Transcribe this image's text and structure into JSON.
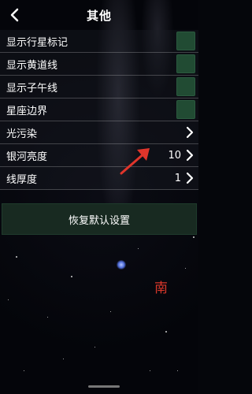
{
  "header": {
    "title": "其他"
  },
  "rows": [
    {
      "label": "显示行星标记",
      "type": "toggle"
    },
    {
      "label": "显示黄道线",
      "type": "toggle"
    },
    {
      "label": "显示子午线",
      "type": "toggle"
    },
    {
      "label": "星座边界",
      "type": "toggle"
    },
    {
      "label": "光污染",
      "type": "stepper",
      "value": ""
    },
    {
      "label": "银河亮度",
      "type": "stepper",
      "value": "10"
    },
    {
      "label": "线厚度",
      "type": "stepper",
      "value": "1"
    }
  ],
  "reset_button": {
    "label": "恢复默认设置"
  },
  "compass": {
    "south": "南"
  },
  "colors": {
    "toggle": "#214b33",
    "accent": "#d9372a",
    "button": "#182a21"
  }
}
